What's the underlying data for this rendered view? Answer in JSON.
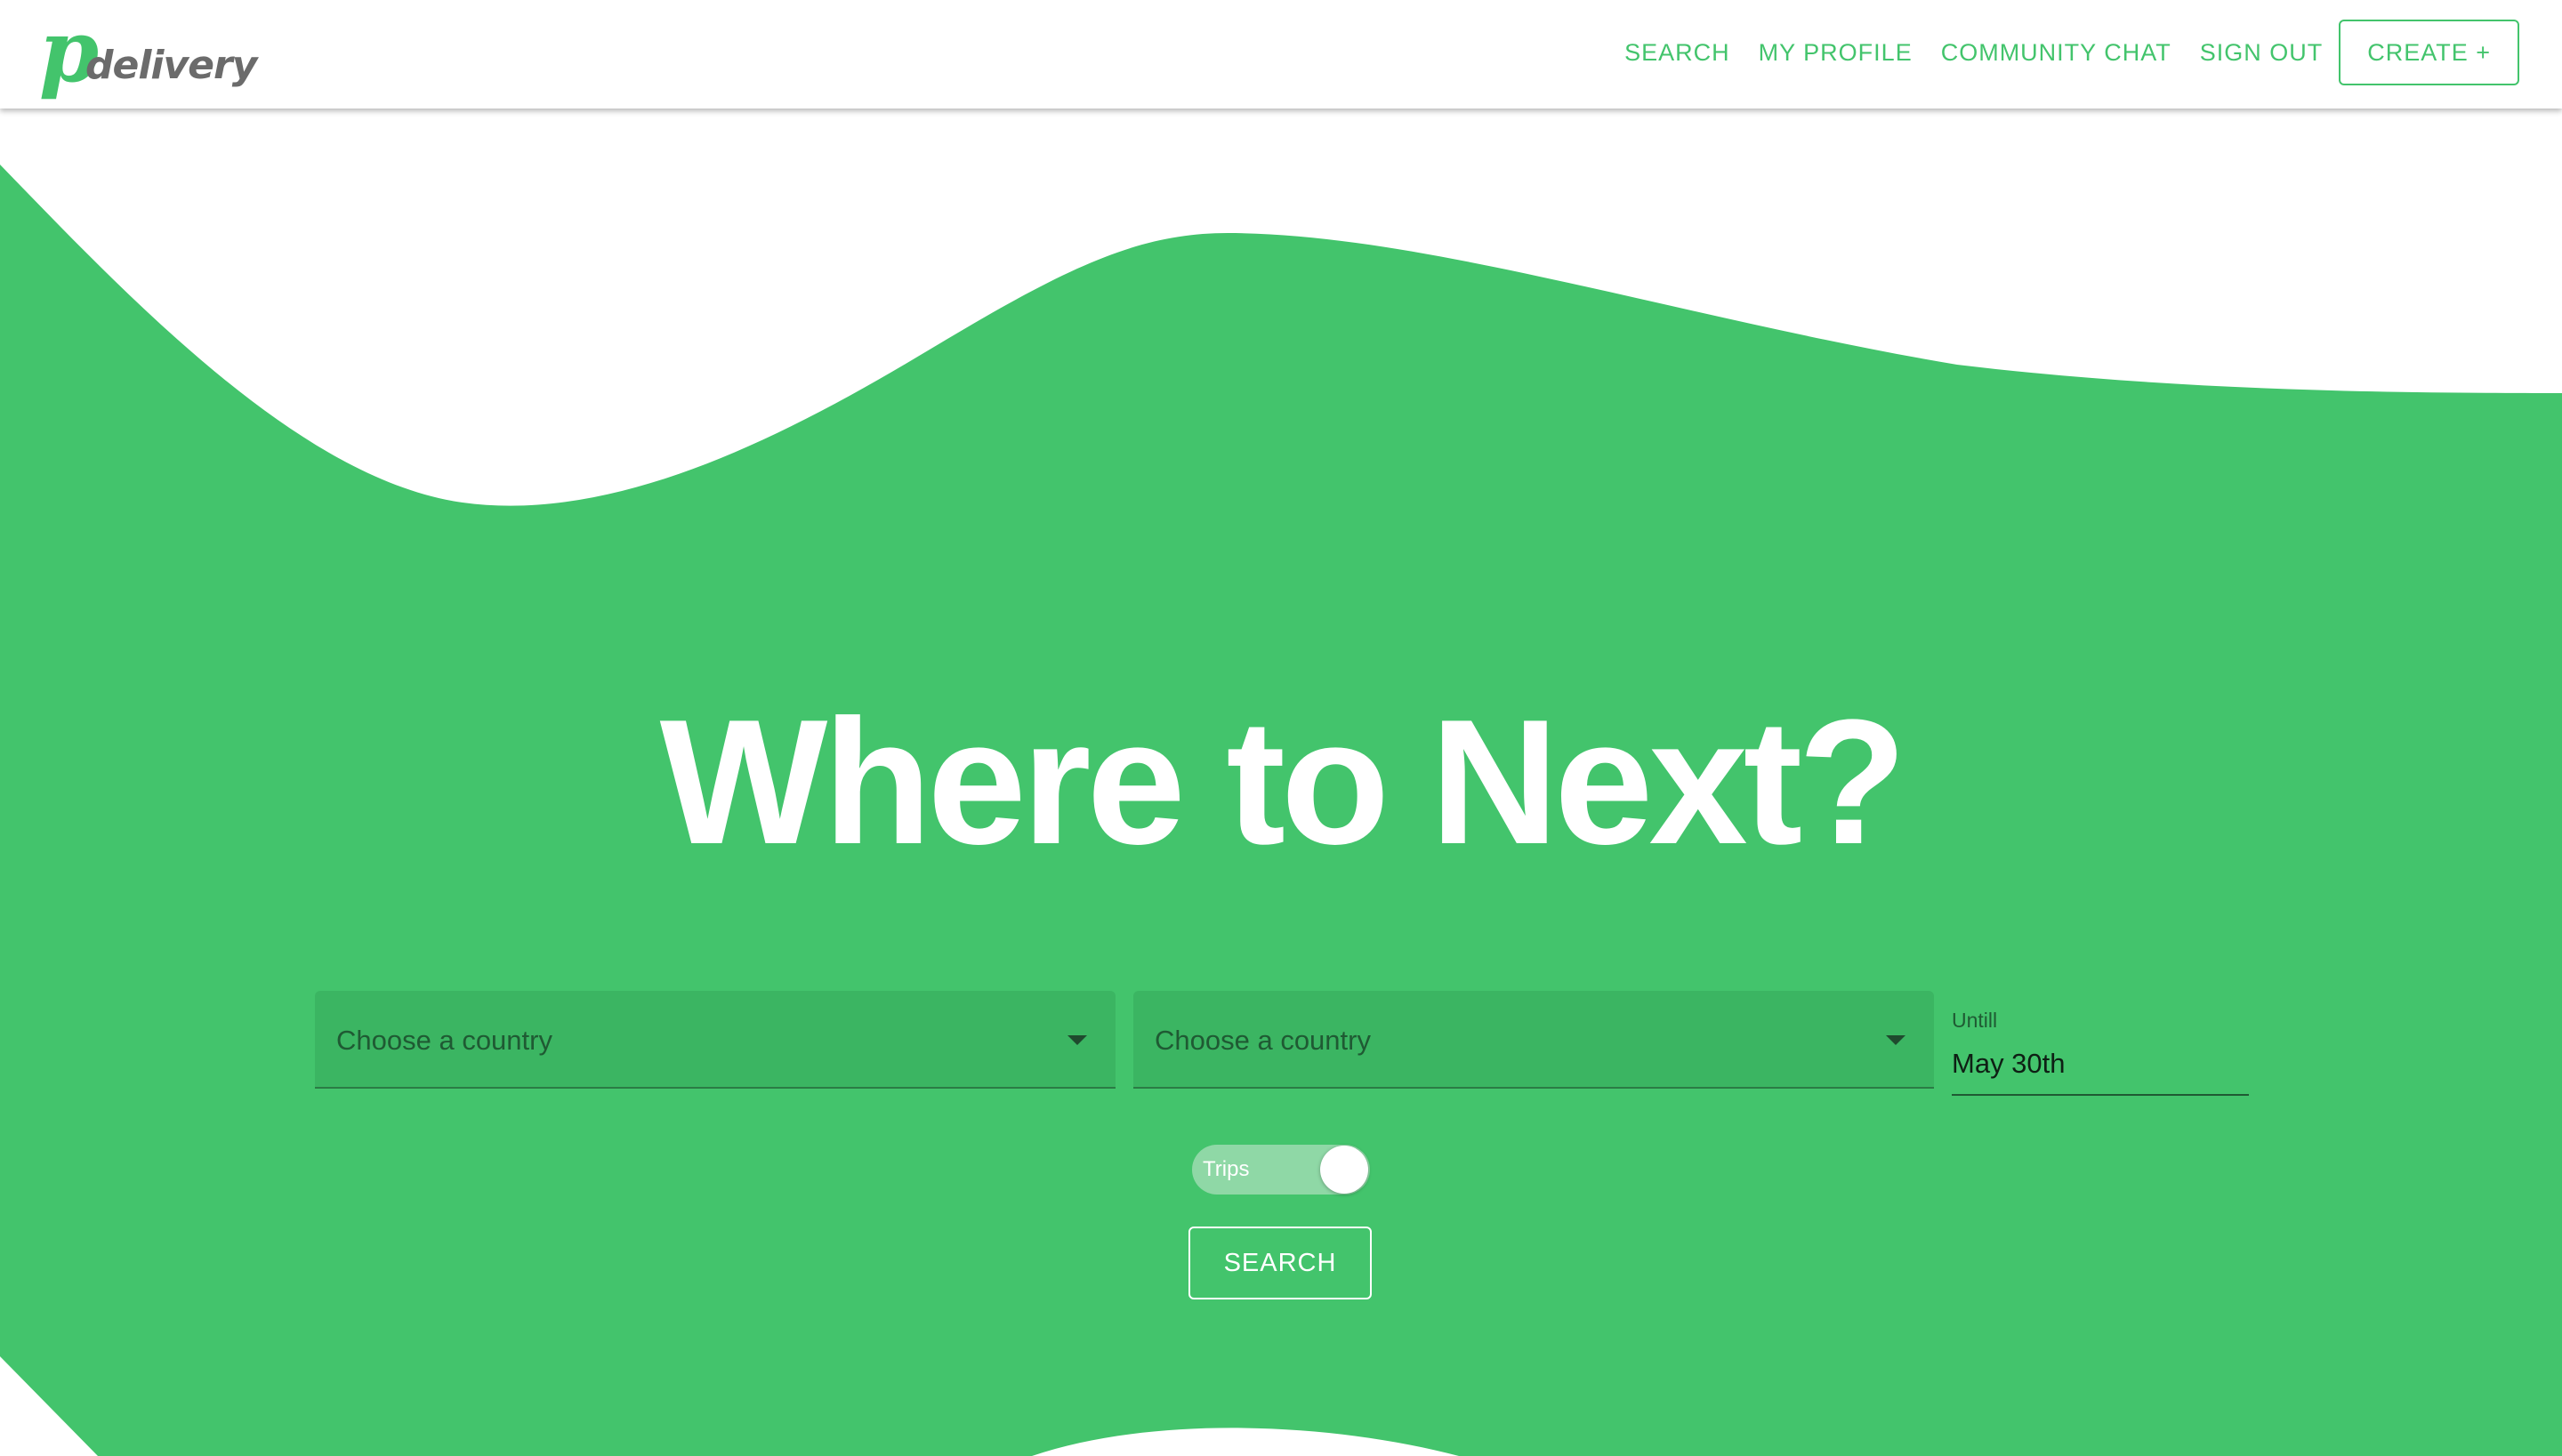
{
  "brand": {
    "logo_mark": "p",
    "logo_word": "delivery"
  },
  "nav": {
    "links": [
      "SEARCH",
      "MY PROFILE",
      "COMMUNITY CHAT",
      "SIGN OUT"
    ],
    "create_label": "CREATE +"
  },
  "hero": {
    "title": "Where to Next?"
  },
  "form": {
    "from_placeholder": "Choose a country",
    "to_placeholder": "Choose a country",
    "date_label": "Untill",
    "date_value": "May 30th",
    "toggle_label": "Trips",
    "search_label": "SEARCH"
  },
  "colors": {
    "brand_green": "#43c46c",
    "select_bg": "#3bb562",
    "toggle_track": "#8fd8a6",
    "logo_grey": "#6b6b6b"
  }
}
